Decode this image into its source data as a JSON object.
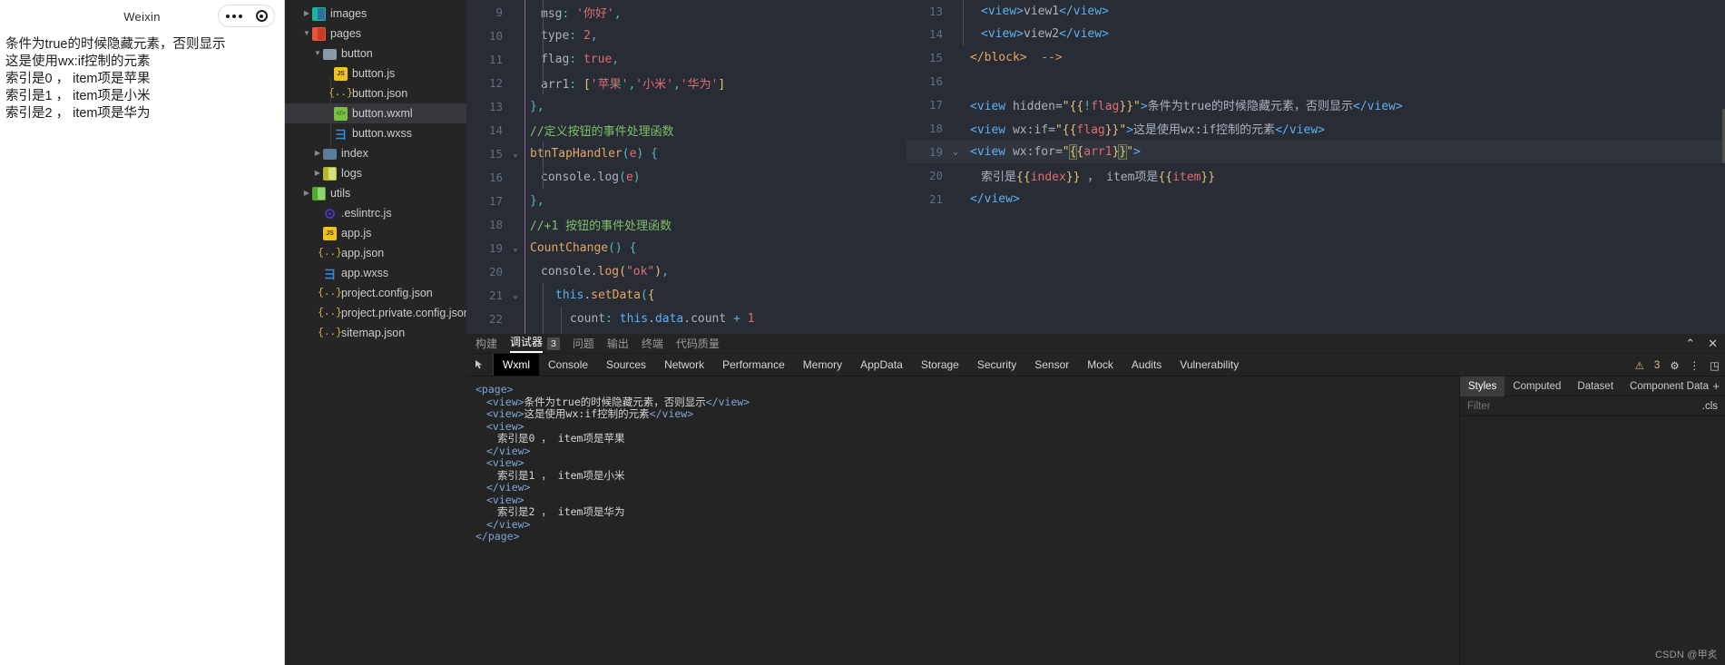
{
  "simulator": {
    "title": "Weixin",
    "capsule": {
      "more_icon": "more-dots-icon",
      "target_icon": "target-icon"
    },
    "lines": [
      "条件为true的时候隐藏元素，否则显示",
      "这是使用wx:if控制的元素",
      "索引是0 ， item项是苹果",
      "索引是1 ， item项是小米",
      "索引是2 ， item项是华为"
    ]
  },
  "filetree": {
    "items": [
      {
        "label": "images",
        "indent": 1,
        "arrow": "▸",
        "icon": "folder-images-icon",
        "selected": false
      },
      {
        "label": "pages",
        "indent": 1,
        "arrow": "▾",
        "icon": "folder-pages-icon",
        "selected": false
      },
      {
        "label": "button",
        "indent": 2,
        "arrow": "▾",
        "icon": "folder-open-icon",
        "selected": false
      },
      {
        "label": "button.js",
        "indent": 3,
        "arrow": "",
        "icon": "js-file-icon",
        "selected": false
      },
      {
        "label": "button.json",
        "indent": 3,
        "arrow": "",
        "icon": "json-file-icon",
        "selected": false
      },
      {
        "label": "button.wxml",
        "indent": 3,
        "arrow": "",
        "icon": "wxml-file-icon",
        "selected": true
      },
      {
        "label": "button.wxss",
        "indent": 3,
        "arrow": "",
        "icon": "wxss-file-icon",
        "selected": false
      },
      {
        "label": "index",
        "indent": 2,
        "arrow": "▸",
        "icon": "folder-plain-icon",
        "selected": false
      },
      {
        "label": "logs",
        "indent": 2,
        "arrow": "▸",
        "icon": "folder-logs-icon",
        "selected": false
      },
      {
        "label": "utils",
        "indent": 1,
        "arrow": "▸",
        "icon": "folder-utils-icon",
        "selected": false
      },
      {
        "label": ".eslintrc.js",
        "indent": 2,
        "arrow": "",
        "icon": "eslint-file-icon",
        "selected": false
      },
      {
        "label": "app.js",
        "indent": 2,
        "arrow": "",
        "icon": "js-file-icon",
        "selected": false
      },
      {
        "label": "app.json",
        "indent": 2,
        "arrow": "",
        "icon": "json-file-icon",
        "selected": false
      },
      {
        "label": "app.wxss",
        "indent": 2,
        "arrow": "",
        "icon": "wxss-file-icon",
        "selected": false
      },
      {
        "label": "project.config.json",
        "indent": 2,
        "arrow": "",
        "icon": "json-file-icon",
        "selected": false
      },
      {
        "label": "project.private.config.json",
        "indent": 2,
        "arrow": "",
        "icon": "json-file-icon",
        "selected": false
      },
      {
        "label": "sitemap.json",
        "indent": 2,
        "arrow": "",
        "icon": "json-file-icon",
        "selected": false
      }
    ]
  },
  "editor_js": {
    "lines": [
      {
        "no": "9",
        "fold": "",
        "hl": false
      },
      {
        "no": "10",
        "fold": "",
        "hl": false
      },
      {
        "no": "11",
        "fold": "",
        "hl": false
      },
      {
        "no": "12",
        "fold": "",
        "hl": false
      },
      {
        "no": "13",
        "fold": "",
        "hl": false
      },
      {
        "no": "14",
        "fold": "",
        "hl": false
      },
      {
        "no": "15",
        "fold": "⌄",
        "hl": false
      },
      {
        "no": "16",
        "fold": "",
        "hl": false
      },
      {
        "no": "17",
        "fold": "",
        "hl": false
      },
      {
        "no": "18",
        "fold": "",
        "hl": false
      },
      {
        "no": "19",
        "fold": "⌄",
        "hl": false
      },
      {
        "no": "20",
        "fold": "",
        "hl": false
      },
      {
        "no": "21",
        "fold": "⌄",
        "hl": false
      },
      {
        "no": "22",
        "fold": "",
        "hl": false
      }
    ],
    "code": [
      "msg: '你好',",
      "type: 2,",
      "flag: true,",
      "arr1: ['苹果','小米','华为']",
      "},",
      "//定义按钮的事件处理函数",
      "btnTapHandler(e) {",
      "console.log(e)",
      "},",
      "//+1 按钮的事件处理函数",
      "CountChange() {",
      "console.log(\"ok\"),",
      "this.setData({",
      "count: this.data.count + 1"
    ]
  },
  "editor_wxml": {
    "lines": [
      {
        "no": "13",
        "fold": "",
        "hl": false
      },
      {
        "no": "14",
        "fold": "",
        "hl": false
      },
      {
        "no": "15",
        "fold": "",
        "hl": false
      },
      {
        "no": "16",
        "fold": "",
        "hl": false
      },
      {
        "no": "17",
        "fold": "",
        "hl": false
      },
      {
        "no": "18",
        "fold": "",
        "hl": false
      },
      {
        "no": "19",
        "fold": "⌄",
        "hl": true
      },
      {
        "no": "20",
        "fold": "",
        "hl": false
      },
      {
        "no": "21",
        "fold": "",
        "hl": false
      }
    ],
    "code": [
      "<view>view1</view>",
      "<view>view2</view>",
      "</block>  -->",
      "",
      "<view hidden=\"{{!flag}}\">条件为true的时候隐藏元素，否则显示</view>",
      "<view wx:if=\"{{flag}}\">这是使用wx:if控制的元素</view>",
      "<view wx:for=\"{{arr1}}\">",
      "索引是{{index}} ， item项是{{item}}",
      "</view>"
    ]
  },
  "devtools": {
    "subtabs": [
      {
        "label": "构建",
        "active": false,
        "badge": ""
      },
      {
        "label": "调试器",
        "active": true,
        "badge": "3"
      },
      {
        "label": "问题",
        "active": false,
        "badge": ""
      },
      {
        "label": "输出",
        "active": false,
        "badge": ""
      },
      {
        "label": "终端",
        "active": false,
        "badge": ""
      },
      {
        "label": "代码质量",
        "active": false,
        "badge": ""
      }
    ],
    "collapse_icon": "chevron-up-icon",
    "close_icon": "close-icon",
    "cursor_icon": "inspect-cursor-icon",
    "tabs": [
      {
        "label": "Wxml",
        "active": true
      },
      {
        "label": "Console",
        "active": false
      },
      {
        "label": "Sources",
        "active": false
      },
      {
        "label": "Network",
        "active": false
      },
      {
        "label": "Performance",
        "active": false
      },
      {
        "label": "Memory",
        "active": false
      },
      {
        "label": "AppData",
        "active": false
      },
      {
        "label": "Storage",
        "active": false
      },
      {
        "label": "Security",
        "active": false
      },
      {
        "label": "Sensor",
        "active": false
      },
      {
        "label": "Mock",
        "active": false
      },
      {
        "label": "Audits",
        "active": false
      },
      {
        "label": "Vulnerability",
        "active": false
      }
    ],
    "warning_icon": "warning-triangle-icon",
    "warning_count": "3",
    "gear_icon": "gear-icon",
    "kebab_icon": "more-vertical-icon",
    "dock_icon": "dock-panel-icon",
    "wxml_tree": [
      {
        "indent": 0,
        "tag_open": "<page>",
        "text": "",
        "tag_close": ""
      },
      {
        "indent": 1,
        "tag_open": "<view>",
        "text": "条件为true的时候隐藏元素，否则显示",
        "tag_close": "</view>"
      },
      {
        "indent": 1,
        "tag_open": "<view>",
        "text": "这是使用wx:if控制的元素",
        "tag_close": "</view>"
      },
      {
        "indent": 1,
        "tag_open": "<view>",
        "text": "",
        "tag_close": ""
      },
      {
        "indent": 2,
        "tag_open": "",
        "text": "索引是0 ， item项是苹果",
        "tag_close": ""
      },
      {
        "indent": 1,
        "tag_open": "</view>",
        "text": "",
        "tag_close": ""
      },
      {
        "indent": 1,
        "tag_open": "<view>",
        "text": "",
        "tag_close": ""
      },
      {
        "indent": 2,
        "tag_open": "",
        "text": "索引是1 ， item项是小米",
        "tag_close": ""
      },
      {
        "indent": 1,
        "tag_open": "</view>",
        "text": "",
        "tag_close": ""
      },
      {
        "indent": 1,
        "tag_open": "<view>",
        "text": "",
        "tag_close": ""
      },
      {
        "indent": 2,
        "tag_open": "",
        "text": "索引是2 ， item项是华为",
        "tag_close": ""
      },
      {
        "indent": 1,
        "tag_open": "</view>",
        "text": "",
        "tag_close": ""
      },
      {
        "indent": 0,
        "tag_open": "</page>",
        "text": "",
        "tag_close": ""
      }
    ],
    "styles_panel": {
      "tabs": [
        {
          "label": "Styles",
          "active": true
        },
        {
          "label": "Computed",
          "active": false
        },
        {
          "label": "Dataset",
          "active": false
        },
        {
          "label": "Component Data",
          "active": false
        }
      ],
      "add_icon": "plus-icon",
      "filter_placeholder": "Filter",
      "filter_value": "",
      "cls_label": ".cls"
    }
  },
  "watermark": "CSDN @甲炙",
  "colors": {
    "editor_bg": "#282c34",
    "panel_bg": "#242424",
    "tree_bg": "#252526",
    "accent_selected": "#37373d",
    "tab_active_bg": "#000000",
    "warning": "#e2c08d"
  }
}
